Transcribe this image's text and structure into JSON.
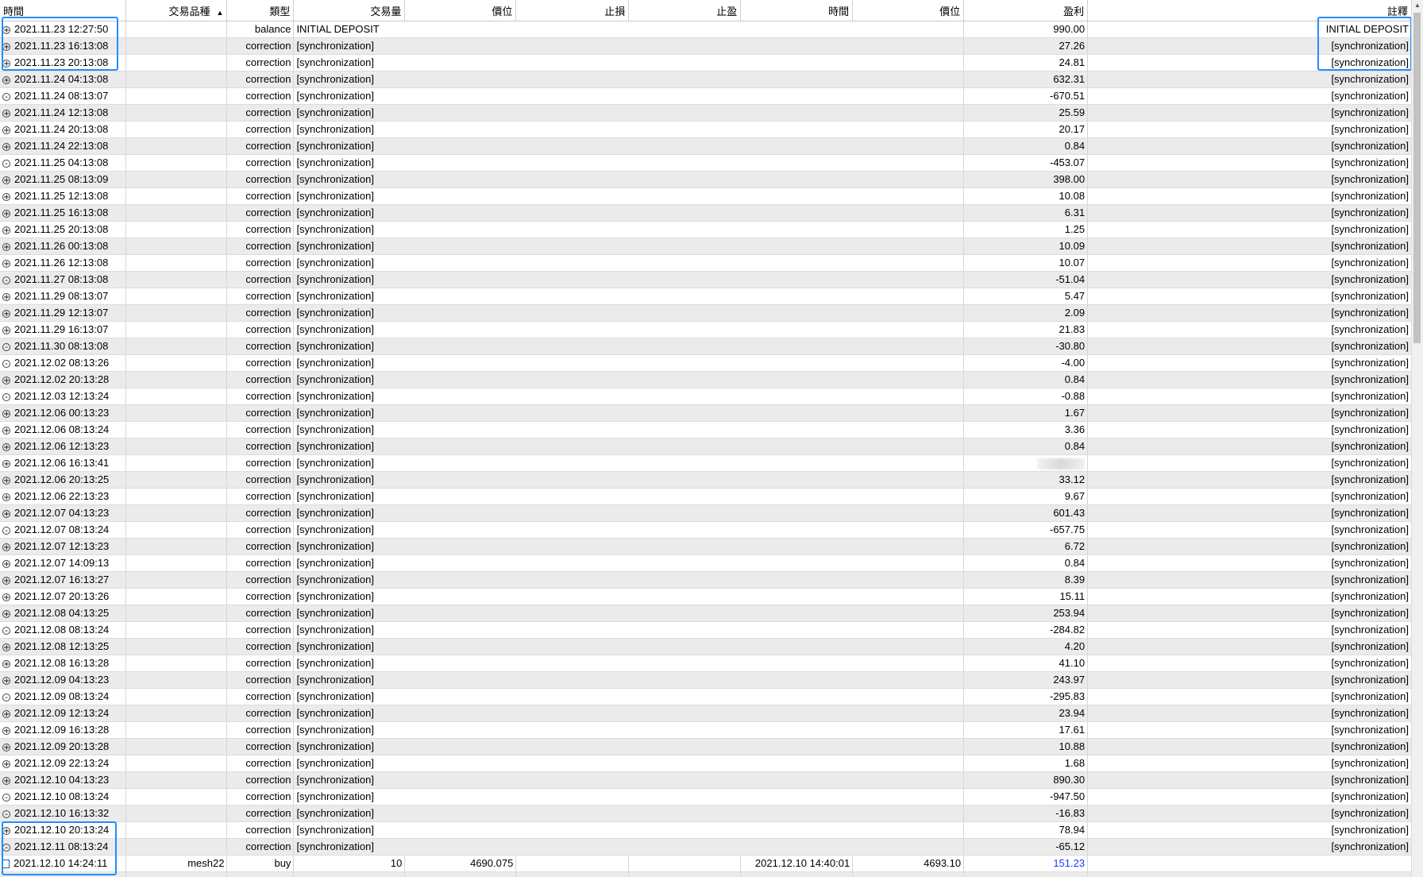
{
  "headers": [
    "時間",
    "交易品種",
    "類型",
    "交易量",
    "價位",
    "止損",
    "止盈",
    "時間",
    "價位",
    "盈利",
    "註釋"
  ],
  "rows": [
    {
      "exp": "+",
      "time": "2021.11.23 12:27:50",
      "type": "balance",
      "desc": "INITIAL DEPOSIT",
      "profit": "990.00",
      "comment": "INITIAL DEPOSIT"
    },
    {
      "exp": "+",
      "time": "2021.11.23 16:13:08",
      "type": "correction",
      "desc": "[synchronization]",
      "profit": "27.26",
      "comment": "[synchronization]"
    },
    {
      "exp": "+",
      "time": "2021.11.23 20:13:08",
      "type": "correction",
      "desc": "[synchronization]",
      "profit": "24.81",
      "comment": "[synchronization]"
    },
    {
      "exp": "+",
      "time": "2021.11.24 04:13:08",
      "type": "correction",
      "desc": "[synchronization]",
      "profit": "632.31",
      "comment": "[synchronization]"
    },
    {
      "exp": "-",
      "time": "2021.11.24 08:13:07",
      "type": "correction",
      "desc": "[synchronization]",
      "profit": "-670.51",
      "comment": "[synchronization]"
    },
    {
      "exp": "+",
      "time": "2021.11.24 12:13:08",
      "type": "correction",
      "desc": "[synchronization]",
      "profit": "25.59",
      "comment": "[synchronization]"
    },
    {
      "exp": "+",
      "time": "2021.11.24 20:13:08",
      "type": "correction",
      "desc": "[synchronization]",
      "profit": "20.17",
      "comment": "[synchronization]"
    },
    {
      "exp": "+",
      "time": "2021.11.24 22:13:08",
      "type": "correction",
      "desc": "[synchronization]",
      "profit": "0.84",
      "comment": "[synchronization]"
    },
    {
      "exp": "-",
      "time": "2021.11.25 04:13:08",
      "type": "correction",
      "desc": "[synchronization]",
      "profit": "-453.07",
      "comment": "[synchronization]"
    },
    {
      "exp": "+",
      "time": "2021.11.25 08:13:09",
      "type": "correction",
      "desc": "[synchronization]",
      "profit": "398.00",
      "comment": "[synchronization]"
    },
    {
      "exp": "+",
      "time": "2021.11.25 12:13:08",
      "type": "correction",
      "desc": "[synchronization]",
      "profit": "10.08",
      "comment": "[synchronization]"
    },
    {
      "exp": "+",
      "time": "2021.11.25 16:13:08",
      "type": "correction",
      "desc": "[synchronization]",
      "profit": "6.31",
      "comment": "[synchronization]"
    },
    {
      "exp": "+",
      "time": "2021.11.25 20:13:08",
      "type": "correction",
      "desc": "[synchronization]",
      "profit": "1.25",
      "comment": "[synchronization]"
    },
    {
      "exp": "+",
      "time": "2021.11.26 00:13:08",
      "type": "correction",
      "desc": "[synchronization]",
      "profit": "10.09",
      "comment": "[synchronization]"
    },
    {
      "exp": "+",
      "time": "2021.11.26 12:13:08",
      "type": "correction",
      "desc": "[synchronization]",
      "profit": "10.07",
      "comment": "[synchronization]"
    },
    {
      "exp": "-",
      "time": "2021.11.27 08:13:08",
      "type": "correction",
      "desc": "[synchronization]",
      "profit": "-51.04",
      "comment": "[synchronization]"
    },
    {
      "exp": "+",
      "time": "2021.11.29 08:13:07",
      "type": "correction",
      "desc": "[synchronization]",
      "profit": "5.47",
      "comment": "[synchronization]"
    },
    {
      "exp": "+",
      "time": "2021.11.29 12:13:07",
      "type": "correction",
      "desc": "[synchronization]",
      "profit": "2.09",
      "comment": "[synchronization]"
    },
    {
      "exp": "+",
      "time": "2021.11.29 16:13:07",
      "type": "correction",
      "desc": "[synchronization]",
      "profit": "21.83",
      "comment": "[synchronization]"
    },
    {
      "exp": "-",
      "time": "2021.11.30 08:13:08",
      "type": "correction",
      "desc": "[synchronization]",
      "profit": "-30.80",
      "comment": "[synchronization]"
    },
    {
      "exp": "-",
      "time": "2021.12.02 08:13:26",
      "type": "correction",
      "desc": "[synchronization]",
      "profit": "-4.00",
      "comment": "[synchronization]"
    },
    {
      "exp": "+",
      "time": "2021.12.02 20:13:28",
      "type": "correction",
      "desc": "[synchronization]",
      "profit": "0.84",
      "comment": "[synchronization]"
    },
    {
      "exp": "-",
      "time": "2021.12.03 12:13:24",
      "type": "correction",
      "desc": "[synchronization]",
      "profit": "-0.88",
      "comment": "[synchronization]"
    },
    {
      "exp": "+",
      "time": "2021.12.06 00:13:23",
      "type": "correction",
      "desc": "[synchronization]",
      "profit": "1.67",
      "comment": "[synchronization]"
    },
    {
      "exp": "+",
      "time": "2021.12.06 08:13:24",
      "type": "correction",
      "desc": "[synchronization]",
      "profit": "3.36",
      "comment": "[synchronization]"
    },
    {
      "exp": "+",
      "time": "2021.12.06 12:13:23",
      "type": "correction",
      "desc": "[synchronization]",
      "profit": "0.84",
      "comment": "[synchronization]"
    },
    {
      "exp": "+",
      "time": "2021.12.06 16:13:41",
      "type": "correction",
      "desc": "[synchronization]",
      "profit": "",
      "blurred": true,
      "comment": "[synchronization]"
    },
    {
      "exp": "+",
      "time": "2021.12.06 20:13:25",
      "type": "correction",
      "desc": "[synchronization]",
      "profit": "33.12",
      "comment": "[synchronization]"
    },
    {
      "exp": "+",
      "time": "2021.12.06 22:13:23",
      "type": "correction",
      "desc": "[synchronization]",
      "profit": "9.67",
      "comment": "[synchronization]"
    },
    {
      "exp": "+",
      "time": "2021.12.07 04:13:23",
      "type": "correction",
      "desc": "[synchronization]",
      "profit": "601.43",
      "comment": "[synchronization]"
    },
    {
      "exp": "-",
      "time": "2021.12.07 08:13:24",
      "type": "correction",
      "desc": "[synchronization]",
      "profit": "-657.75",
      "comment": "[synchronization]"
    },
    {
      "exp": "+",
      "time": "2021.12.07 12:13:23",
      "type": "correction",
      "desc": "[synchronization]",
      "profit": "6.72",
      "comment": "[synchronization]"
    },
    {
      "exp": "+",
      "time": "2021.12.07 14:09:13",
      "type": "correction",
      "desc": "[synchronization]",
      "profit": "0.84",
      "comment": "[synchronization]"
    },
    {
      "exp": "+",
      "time": "2021.12.07 16:13:27",
      "type": "correction",
      "desc": "[synchronization]",
      "profit": "8.39",
      "comment": "[synchronization]"
    },
    {
      "exp": "+",
      "time": "2021.12.07 20:13:26",
      "type": "correction",
      "desc": "[synchronization]",
      "profit": "15.11",
      "comment": "[synchronization]"
    },
    {
      "exp": "+",
      "time": "2021.12.08 04:13:25",
      "type": "correction",
      "desc": "[synchronization]",
      "profit": "253.94",
      "comment": "[synchronization]"
    },
    {
      "exp": "-",
      "time": "2021.12.08 08:13:24",
      "type": "correction",
      "desc": "[synchronization]",
      "profit": "-284.82",
      "comment": "[synchronization]"
    },
    {
      "exp": "+",
      "time": "2021.12.08 12:13:25",
      "type": "correction",
      "desc": "[synchronization]",
      "profit": "4.20",
      "comment": "[synchronization]"
    },
    {
      "exp": "+",
      "time": "2021.12.08 16:13:28",
      "type": "correction",
      "desc": "[synchronization]",
      "profit": "41.10",
      "comment": "[synchronization]"
    },
    {
      "exp": "+",
      "time": "2021.12.09 04:13:23",
      "type": "correction",
      "desc": "[synchronization]",
      "profit": "243.97",
      "comment": "[synchronization]"
    },
    {
      "exp": "-",
      "time": "2021.12.09 08:13:24",
      "type": "correction",
      "desc": "[synchronization]",
      "profit": "-295.83",
      "comment": "[synchronization]"
    },
    {
      "exp": "+",
      "time": "2021.12.09 12:13:24",
      "type": "correction",
      "desc": "[synchronization]",
      "profit": "23.94",
      "comment": "[synchronization]"
    },
    {
      "exp": "+",
      "time": "2021.12.09 16:13:28",
      "type": "correction",
      "desc": "[synchronization]",
      "profit": "17.61",
      "comment": "[synchronization]"
    },
    {
      "exp": "+",
      "time": "2021.12.09 20:13:28",
      "type": "correction",
      "desc": "[synchronization]",
      "profit": "10.88",
      "comment": "[synchronization]"
    },
    {
      "exp": "+",
      "time": "2021.12.09 22:13:24",
      "type": "correction",
      "desc": "[synchronization]",
      "profit": "1.68",
      "comment": "[synchronization]"
    },
    {
      "exp": "+",
      "time": "2021.12.10 04:13:23",
      "type": "correction",
      "desc": "[synchronization]",
      "profit": "890.30",
      "comment": "[synchronization]"
    },
    {
      "exp": "-",
      "time": "2021.12.10 08:13:24",
      "type": "correction",
      "desc": "[synchronization]",
      "profit": "-947.50",
      "comment": "[synchronization]"
    },
    {
      "exp": "-",
      "time": "2021.12.10 16:13:32",
      "type": "correction",
      "desc": "[synchronization]",
      "profit": "-16.83",
      "comment": "[synchronization]"
    },
    {
      "exp": "+",
      "time": "2021.12.10 20:13:24",
      "type": "correction",
      "desc": "[synchronization]",
      "profit": "78.94",
      "comment": "[synchronization]"
    },
    {
      "exp": "-",
      "time": "2021.12.11 08:13:24",
      "type": "correction",
      "desc": "[synchronization]",
      "profit": "-65.12",
      "comment": "[synchronization]"
    }
  ],
  "trade_row": {
    "time": "2021.12.10 14:24:11",
    "symbol": "mesh22",
    "type": "buy",
    "volume": "10",
    "price": "4690.075",
    "close_time": "2021.12.10 14:40:01",
    "close_price": "4693.10",
    "profit": "151.23"
  },
  "colors": {
    "highlight": "#1f8fff",
    "profit_link": "#1a3cff",
    "alt_row": "#ebebeb"
  }
}
